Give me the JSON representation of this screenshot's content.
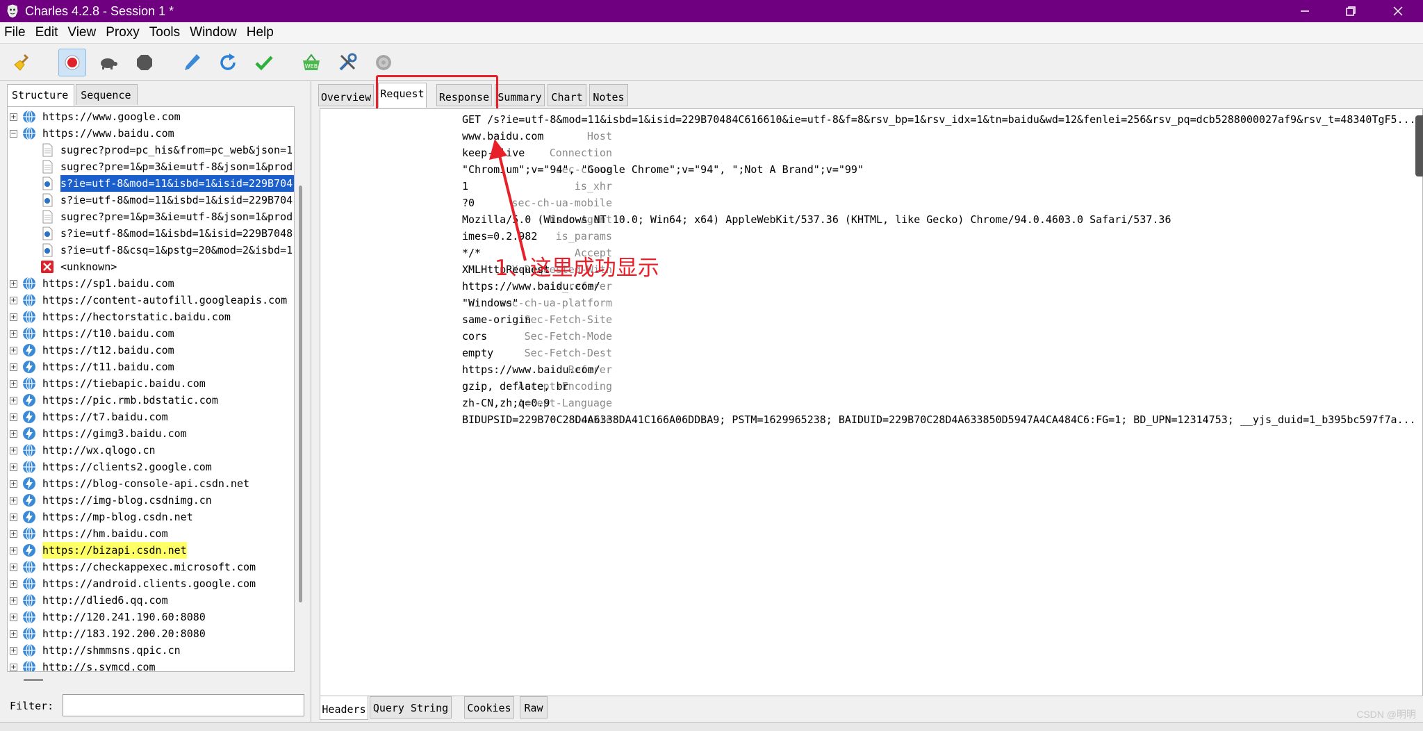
{
  "window": {
    "title": "Charles 4.2.8 - Session 1 *"
  },
  "menu": [
    "File",
    "Edit",
    "View",
    "Proxy",
    "Tools",
    "Window",
    "Help"
  ],
  "toolbar": {
    "icons": [
      "broom-icon",
      "record-icon",
      "turtle-icon",
      "stop-icon",
      "pen-icon",
      "refresh-icon",
      "check-icon",
      "basket-icon",
      "tools-icon",
      "gear-icon"
    ]
  },
  "left_tabs": [
    "Structure",
    "Sequence"
  ],
  "tree": [
    {
      "label": "https://www.google.com",
      "type": "host",
      "expanded": false
    },
    {
      "label": "https://www.baidu.com",
      "type": "host",
      "expanded": true
    },
    {
      "label": "sugrec?prod=pc_his&from=pc_web&json=1",
      "type": "doc"
    },
    {
      "label": "sugrec?pre=1&p=3&ie=utf-8&json=1&prod",
      "type": "doc"
    },
    {
      "label": "s?ie=utf-8&mod=11&isbd=1&isid=229B704",
      "type": "req",
      "selected": true
    },
    {
      "label": "s?ie=utf-8&mod=11&isbd=1&isid=229B704",
      "type": "req"
    },
    {
      "label": "sugrec?pre=1&p=3&ie=utf-8&json=1&prod",
      "type": "doc"
    },
    {
      "label": "s?ie=utf-8&mod=1&isbd=1&isid=229B7048",
      "type": "req"
    },
    {
      "label": "s?ie=utf-8&csq=1&pstg=20&mod=2&isbd=1",
      "type": "req"
    },
    {
      "label": "<unknown>",
      "type": "error"
    },
    {
      "label": "https://sp1.baidu.com",
      "type": "host"
    },
    {
      "label": "https://content-autofill.googleapis.com",
      "type": "host"
    },
    {
      "label": "https://hectorstatic.baidu.com",
      "type": "host"
    },
    {
      "label": "https://t10.baidu.com",
      "type": "host"
    },
    {
      "label": "https://t12.baidu.com",
      "type": "bolt"
    },
    {
      "label": "https://t11.baidu.com",
      "type": "bolt"
    },
    {
      "label": "https://tiebapic.baidu.com",
      "type": "host"
    },
    {
      "label": "https://pic.rmb.bdstatic.com",
      "type": "bolt"
    },
    {
      "label": "https://t7.baidu.com",
      "type": "bolt"
    },
    {
      "label": "https://gimg3.baidu.com",
      "type": "bolt"
    },
    {
      "label": "http://wx.qlogo.cn",
      "type": "host"
    },
    {
      "label": "https://clients2.google.com",
      "type": "host"
    },
    {
      "label": "https://blog-console-api.csdn.net",
      "type": "bolt"
    },
    {
      "label": "https://img-blog.csdnimg.cn",
      "type": "bolt"
    },
    {
      "label": "https://mp-blog.csdn.net",
      "type": "bolt"
    },
    {
      "label": "https://hm.baidu.com",
      "type": "host"
    },
    {
      "label": "https://bizapi.csdn.net",
      "type": "bolt",
      "highlight": true
    },
    {
      "label": "https://checkappexec.microsoft.com",
      "type": "host"
    },
    {
      "label": "https://android.clients.google.com",
      "type": "host"
    },
    {
      "label": "http://dlied6.qq.com",
      "type": "host"
    },
    {
      "label": "http://120.241.190.60:8080",
      "type": "host"
    },
    {
      "label": "http://183.192.200.20:8080",
      "type": "host"
    },
    {
      "label": "http://shmmsns.qpic.cn",
      "type": "host"
    },
    {
      "label": "http://s.symcd.com",
      "type": "host"
    }
  ],
  "filter": {
    "label": "Filter:",
    "value": ""
  },
  "right_tabs": [
    "Overview",
    "Request",
    "Response",
    "Summary",
    "Chart",
    "Notes"
  ],
  "headers": [
    {
      "key": "",
      "value": "GET /s?ie=utf-8&mod=11&isbd=1&isid=229B70484C616610&ie=utf-8&f=8&rsv_bp=1&rsv_idx=1&tn=baidu&wd=12&fenlei=256&rsv_pq=dcb5288000027af9&rsv_t=48340TgF5..."
    },
    {
      "key": "Host",
      "value": "www.baidu.com"
    },
    {
      "key": "Connection",
      "value": "keep-alive"
    },
    {
      "key": "sec-ch-ua",
      "value": "\"Chromium\";v=\"94\", \"Google Chrome\";v=\"94\", \";Not A Brand\";v=\"99\""
    },
    {
      "key": "is_xhr",
      "value": "1"
    },
    {
      "key": "sec-ch-ua-mobile",
      "value": "?0"
    },
    {
      "key": "User-Agent",
      "value": "Mozilla/5.0 (Windows NT 10.0; Win64; x64) AppleWebKit/537.36 (KHTML, like Gecko) Chrome/94.0.4603.0 Safari/537.36"
    },
    {
      "key": "is_params",
      "value": "imes=0.2.982"
    },
    {
      "key": "Accept",
      "value": "*/*"
    },
    {
      "key": "X-Requested-With",
      "value": "XMLHttpRequest"
    },
    {
      "key": "is_referer",
      "value": "https://www.baidu.com/"
    },
    {
      "key": "sec-ch-ua-platform",
      "value": "\"Windows\""
    },
    {
      "key": "Sec-Fetch-Site",
      "value": "same-origin"
    },
    {
      "key": "Sec-Fetch-Mode",
      "value": "cors"
    },
    {
      "key": "Sec-Fetch-Dest",
      "value": "empty"
    },
    {
      "key": "Referer",
      "value": "https://www.baidu.com/"
    },
    {
      "key": "Accept-Encoding",
      "value": "gzip, deflate, br"
    },
    {
      "key": "Accept-Language",
      "value": "zh-CN,zh;q=0.9"
    },
    {
      "key": "Cookie",
      "value": "BIDUPSID=229B70C28D4A6338DA41C166A06DDBA9; PSTM=1629965238; BAIDUID=229B70C28D4A633850D5947A4CA484C6:FG=1; BD_UPN=12314753; __yjs_duid=1_b395bc597f7a..."
    }
  ],
  "annotation": "1、这里成功显示",
  "bottom_tabs": [
    "Headers",
    "Query String",
    "Cookies",
    "Raw"
  ],
  "watermark": "CSDN @明明",
  "colors": {
    "titlebar": "#6f0080",
    "selection": "#1a5fcc",
    "highlight": "#ffff66",
    "annotation": "#e8202a"
  }
}
